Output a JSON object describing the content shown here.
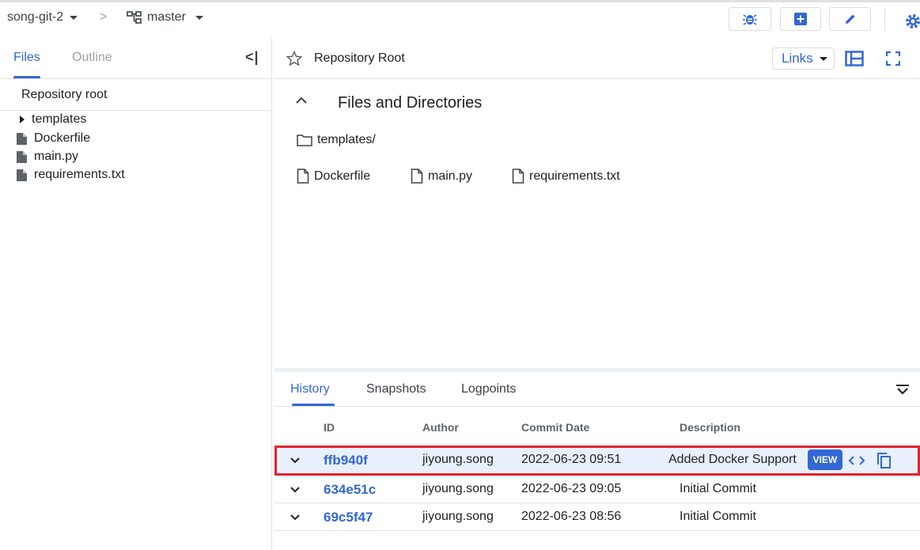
{
  "topbar": {
    "repo": "song-git-2",
    "separator": ">",
    "branch": "master"
  },
  "sidebar": {
    "tabs": [
      {
        "label": "Files"
      },
      {
        "label": "Outline"
      }
    ],
    "collapse_glyph": "<|",
    "repo_root": "Repository root",
    "tree": [
      {
        "label": "templates",
        "icon": "caret-right-icon"
      },
      {
        "label": "Dockerfile",
        "icon": "file-icon"
      },
      {
        "label": "main.py",
        "icon": "file-icon"
      },
      {
        "label": "requirements.txt",
        "icon": "file-icon"
      }
    ]
  },
  "main": {
    "title": "Repository Root",
    "links_label": "Links",
    "section_title": "Files and Directories",
    "folders": [
      {
        "label": "templates/"
      }
    ],
    "files": [
      {
        "label": "Dockerfile"
      },
      {
        "label": "main.py"
      },
      {
        "label": "requirements.txt"
      }
    ]
  },
  "history": {
    "tabs": [
      {
        "label": "History"
      },
      {
        "label": "Snapshots"
      },
      {
        "label": "Logpoints"
      }
    ],
    "columns": {
      "id": "ID",
      "author": "Author",
      "date": "Commit Date",
      "description": "Description"
    },
    "rows": [
      {
        "id": "ffb940f",
        "author": "jiyoung.song",
        "date": "2022-06-23 09:51",
        "description": "Added Docker Support",
        "selected": true,
        "view_label": "VIEW"
      },
      {
        "id": "634e51c",
        "author": "jiyoung.song",
        "date": "2022-06-23 09:05",
        "description": "Initial Commit"
      },
      {
        "id": "69c5f47",
        "author": "jiyoung.song",
        "date": "2022-06-23 08:56",
        "description": "Initial Commit"
      }
    ]
  },
  "colors": {
    "accent": "#3367d6",
    "highlight": "#e5202e",
    "selected_row": "#e8f0fe"
  }
}
